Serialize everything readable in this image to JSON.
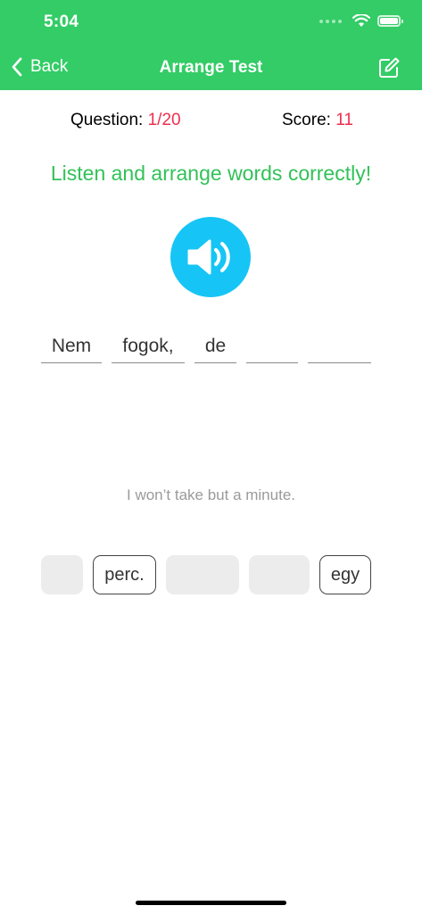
{
  "status_bar": {
    "time": "5:04"
  },
  "nav": {
    "back_label": "Back",
    "title": "Arrange Test",
    "edit_icon": "square-pencil-icon"
  },
  "progress": {
    "question_label": "Question:",
    "question_value": "1/20",
    "score_label": "Score:",
    "score_value": "11"
  },
  "instruction": "Listen and arrange words correctly!",
  "audio_icon": "speaker-wave-icon",
  "answer_slots": [
    "Nem",
    "fogok,",
    "de",
    "",
    ""
  ],
  "translation": "I won’t take but a minute.",
  "word_tiles": [
    "",
    "perc.",
    "",
    "",
    "egy"
  ],
  "colors": {
    "header_green": "#33cc66",
    "instruction_green": "#33c159",
    "accent_red": "#ee2e4f",
    "speaker_blue": "#16c5f5"
  }
}
